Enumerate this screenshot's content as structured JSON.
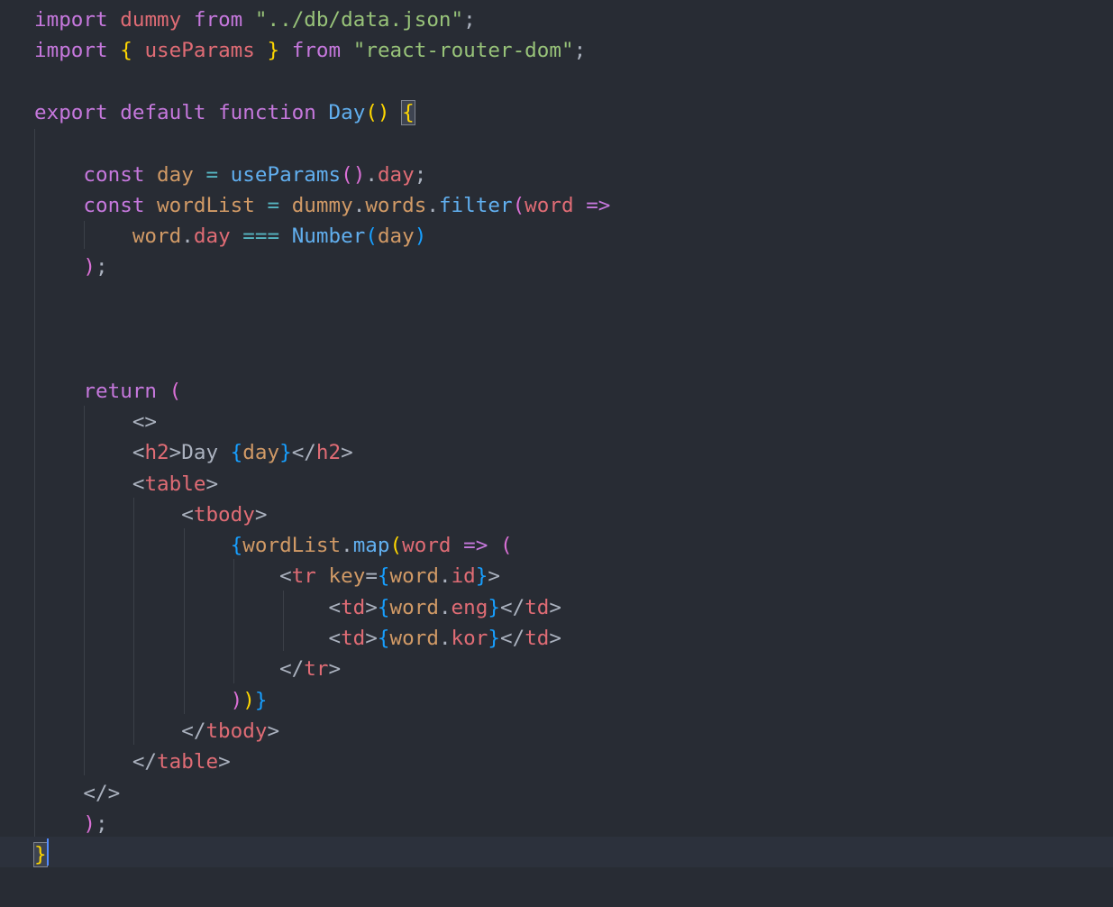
{
  "editor": {
    "theme_colors": {
      "background": "#282c34",
      "keyword": "#c678dd",
      "variable": "#e06c75",
      "string": "#98c379",
      "function": "#61afef",
      "plain": "#abb2bf",
      "bracket_gold": "#ffd700",
      "bracket_orchid": "#da70d6",
      "bracket_blue": "#179fff"
    },
    "lines": [
      [
        {
          "t": "import",
          "c": "kw"
        },
        {
          "t": " ",
          "c": "plain"
        },
        {
          "t": "dummy",
          "c": "var"
        },
        {
          "t": " ",
          "c": "plain"
        },
        {
          "t": "from",
          "c": "kw"
        },
        {
          "t": " ",
          "c": "plain"
        },
        {
          "t": "\"../db/data.json\"",
          "c": "str"
        },
        {
          "t": ";",
          "c": "plain"
        }
      ],
      [
        {
          "t": "import",
          "c": "kw"
        },
        {
          "t": " ",
          "c": "plain"
        },
        {
          "t": "{",
          "c": "b1"
        },
        {
          "t": " ",
          "c": "plain"
        },
        {
          "t": "useParams",
          "c": "var"
        },
        {
          "t": " ",
          "c": "plain"
        },
        {
          "t": "}",
          "c": "b1"
        },
        {
          "t": " ",
          "c": "plain"
        },
        {
          "t": "from",
          "c": "kw"
        },
        {
          "t": " ",
          "c": "plain"
        },
        {
          "t": "\"react-router-dom\"",
          "c": "str"
        },
        {
          "t": ";",
          "c": "plain"
        }
      ],
      [],
      [
        {
          "t": "export",
          "c": "kw"
        },
        {
          "t": " ",
          "c": "plain"
        },
        {
          "t": "default",
          "c": "kw"
        },
        {
          "t": " ",
          "c": "plain"
        },
        {
          "t": "function",
          "c": "kw"
        },
        {
          "t": " ",
          "c": "plain"
        },
        {
          "t": "Day",
          "c": "fn"
        },
        {
          "t": "()",
          "c": "b1"
        },
        {
          "t": " ",
          "c": "plain"
        },
        {
          "t": "{",
          "c": "b1 bracket-match"
        }
      ],
      [],
      [
        {
          "t": "    ",
          "c": "plain"
        },
        {
          "t": "const",
          "c": "kw"
        },
        {
          "t": " ",
          "c": "plain"
        },
        {
          "t": "day",
          "c": "num"
        },
        {
          "t": " = ",
          "c": "op"
        },
        {
          "t": "useParams",
          "c": "fn"
        },
        {
          "t": "()",
          "c": "b2"
        },
        {
          "t": ".",
          "c": "plain"
        },
        {
          "t": "day",
          "c": "prop"
        },
        {
          "t": ";",
          "c": "plain"
        }
      ],
      [
        {
          "t": "    ",
          "c": "plain"
        },
        {
          "t": "const",
          "c": "kw"
        },
        {
          "t": " ",
          "c": "plain"
        },
        {
          "t": "wordList",
          "c": "num"
        },
        {
          "t": " = ",
          "c": "op"
        },
        {
          "t": "dummy",
          "c": "num"
        },
        {
          "t": ".",
          "c": "plain"
        },
        {
          "t": "words",
          "c": "num"
        },
        {
          "t": ".",
          "c": "plain"
        },
        {
          "t": "filter",
          "c": "fn"
        },
        {
          "t": "(",
          "c": "b2"
        },
        {
          "t": "word",
          "c": "var"
        },
        {
          "t": " ",
          "c": "plain"
        },
        {
          "t": "=>",
          "c": "kw"
        }
      ],
      [
        {
          "t": "        ",
          "c": "plain"
        },
        {
          "t": "word",
          "c": "num"
        },
        {
          "t": ".",
          "c": "plain"
        },
        {
          "t": "day",
          "c": "prop"
        },
        {
          "t": " ",
          "c": "plain"
        },
        {
          "t": "===",
          "c": "op"
        },
        {
          "t": " ",
          "c": "plain"
        },
        {
          "t": "Number",
          "c": "ty"
        },
        {
          "t": "(",
          "c": "b3"
        },
        {
          "t": "day",
          "c": "num"
        },
        {
          "t": ")",
          "c": "b3"
        }
      ],
      [
        {
          "t": "    ",
          "c": "plain"
        },
        {
          "t": ")",
          "c": "b2"
        },
        {
          "t": ";",
          "c": "plain"
        }
      ],
      [],
      [],
      [],
      [
        {
          "t": "    ",
          "c": "plain"
        },
        {
          "t": "return",
          "c": "kw"
        },
        {
          "t": " ",
          "c": "plain"
        },
        {
          "t": "(",
          "c": "b2"
        }
      ],
      [
        {
          "t": "        ",
          "c": "plain"
        },
        {
          "t": "<>",
          "c": "plain"
        }
      ],
      [
        {
          "t": "        ",
          "c": "plain"
        },
        {
          "t": "<",
          "c": "plain"
        },
        {
          "t": "h2",
          "c": "tag"
        },
        {
          "t": ">Day ",
          "c": "plain"
        },
        {
          "t": "{",
          "c": "b3"
        },
        {
          "t": "day",
          "c": "num"
        },
        {
          "t": "}",
          "c": "b3"
        },
        {
          "t": "</",
          "c": "plain"
        },
        {
          "t": "h2",
          "c": "tag"
        },
        {
          "t": ">",
          "c": "plain"
        }
      ],
      [
        {
          "t": "        ",
          "c": "plain"
        },
        {
          "t": "<",
          "c": "plain"
        },
        {
          "t": "table",
          "c": "tag"
        },
        {
          "t": ">",
          "c": "plain"
        }
      ],
      [
        {
          "t": "            ",
          "c": "plain"
        },
        {
          "t": "<",
          "c": "plain"
        },
        {
          "t": "tbody",
          "c": "tag"
        },
        {
          "t": ">",
          "c": "plain"
        }
      ],
      [
        {
          "t": "                ",
          "c": "plain"
        },
        {
          "t": "{",
          "c": "b3"
        },
        {
          "t": "wordList",
          "c": "num"
        },
        {
          "t": ".",
          "c": "plain"
        },
        {
          "t": "map",
          "c": "fn"
        },
        {
          "t": "(",
          "c": "b1"
        },
        {
          "t": "word",
          "c": "var"
        },
        {
          "t": " ",
          "c": "plain"
        },
        {
          "t": "=>",
          "c": "kw"
        },
        {
          "t": " ",
          "c": "plain"
        },
        {
          "t": "(",
          "c": "b2"
        }
      ],
      [
        {
          "t": "                    ",
          "c": "plain"
        },
        {
          "t": "<",
          "c": "plain"
        },
        {
          "t": "tr",
          "c": "tag"
        },
        {
          "t": " ",
          "c": "plain"
        },
        {
          "t": "key",
          "c": "attr"
        },
        {
          "t": "=",
          "c": "plain"
        },
        {
          "t": "{",
          "c": "b3"
        },
        {
          "t": "word",
          "c": "num"
        },
        {
          "t": ".",
          "c": "plain"
        },
        {
          "t": "id",
          "c": "prop"
        },
        {
          "t": "}",
          "c": "b3"
        },
        {
          "t": ">",
          "c": "plain"
        }
      ],
      [
        {
          "t": "                        ",
          "c": "plain"
        },
        {
          "t": "<",
          "c": "plain"
        },
        {
          "t": "td",
          "c": "tag"
        },
        {
          "t": ">",
          "c": "plain"
        },
        {
          "t": "{",
          "c": "b3"
        },
        {
          "t": "word",
          "c": "num"
        },
        {
          "t": ".",
          "c": "plain"
        },
        {
          "t": "eng",
          "c": "prop"
        },
        {
          "t": "}",
          "c": "b3"
        },
        {
          "t": "</",
          "c": "plain"
        },
        {
          "t": "td",
          "c": "tag"
        },
        {
          "t": ">",
          "c": "plain"
        }
      ],
      [
        {
          "t": "                        ",
          "c": "plain"
        },
        {
          "t": "<",
          "c": "plain"
        },
        {
          "t": "td",
          "c": "tag"
        },
        {
          "t": ">",
          "c": "plain"
        },
        {
          "t": "{",
          "c": "b3"
        },
        {
          "t": "word",
          "c": "num"
        },
        {
          "t": ".",
          "c": "plain"
        },
        {
          "t": "kor",
          "c": "prop"
        },
        {
          "t": "}",
          "c": "b3"
        },
        {
          "t": "</",
          "c": "plain"
        },
        {
          "t": "td",
          "c": "tag"
        },
        {
          "t": ">",
          "c": "plain"
        }
      ],
      [
        {
          "t": "                    ",
          "c": "plain"
        },
        {
          "t": "</",
          "c": "plain"
        },
        {
          "t": "tr",
          "c": "tag"
        },
        {
          "t": ">",
          "c": "plain"
        }
      ],
      [
        {
          "t": "                ",
          "c": "plain"
        },
        {
          "t": ")",
          "c": "b2"
        },
        {
          "t": ")",
          "c": "b1"
        },
        {
          "t": "}",
          "c": "b3"
        }
      ],
      [
        {
          "t": "            ",
          "c": "plain"
        },
        {
          "t": "</",
          "c": "plain"
        },
        {
          "t": "tbody",
          "c": "tag"
        },
        {
          "t": ">",
          "c": "plain"
        }
      ],
      [
        {
          "t": "        ",
          "c": "plain"
        },
        {
          "t": "</",
          "c": "plain"
        },
        {
          "t": "table",
          "c": "tag"
        },
        {
          "t": ">",
          "c": "plain"
        }
      ],
      [
        {
          "t": "    ",
          "c": "plain"
        },
        {
          "t": "</>",
          "c": "plain"
        }
      ],
      [
        {
          "t": "    ",
          "c": "plain"
        },
        {
          "t": ")",
          "c": "b2"
        },
        {
          "t": ";",
          "c": "plain"
        }
      ],
      [
        {
          "t": "}",
          "c": "b1 bracket-match"
        }
      ]
    ]
  }
}
